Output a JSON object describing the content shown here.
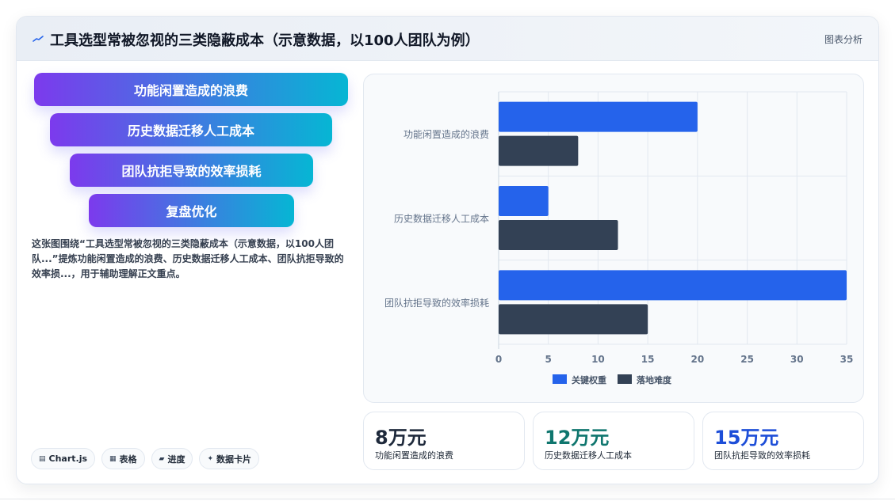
{
  "header": {
    "title": "工具选型常被忽视的三类隐蔽成本（示意数据，以100人团队为例）",
    "right_link": "图表分析",
    "icon": "chart-line-icon"
  },
  "funnel": [
    "功能闲置造成的浪费",
    "历史数据迁移人工成本",
    "团队抗拒导致的效率损耗",
    "复盘优化"
  ],
  "description": "这张图围绕“工具选型常被忽视的三类隐蔽成本（示意数据，以100人团队...”提炼功能闲置造成的浪费、历史数据迁移人工成本、团队抗拒导致的效率损...，用于辅助理解正文重点。",
  "chips": [
    {
      "icon": "▤",
      "label": "Chart.js"
    },
    {
      "icon": "▦",
      "label": "表格"
    },
    {
      "icon": "▰",
      "label": "进度"
    },
    {
      "icon": "✦",
      "label": "数据卡片"
    }
  ],
  "chart_data": {
    "type": "bar",
    "orientation": "horizontal",
    "categories": [
      "功能闲置造成的浪费",
      "历史数据迁移人工成本",
      "团队抗拒导致的效率损耗"
    ],
    "series": [
      {
        "name": "关键权重",
        "values": [
          20,
          5,
          35
        ],
        "color": "#2563eb"
      },
      {
        "name": "落地难度",
        "values": [
          8,
          12,
          15
        ],
        "color": "#334155"
      }
    ],
    "xlim": [
      0,
      35
    ],
    "xticks": [
      0,
      5,
      10,
      15,
      20,
      25,
      30,
      35
    ],
    "grid": true,
    "legend": "bottom"
  },
  "stats": [
    {
      "value": "8万元",
      "label": "功能闲置造成的浪费",
      "color": "#1e293b"
    },
    {
      "value": "12万元",
      "label": "历史数据迁移人工成本",
      "color": "#0f766e"
    },
    {
      "value": "15万元",
      "label": "团队抗拒导致的效率损耗",
      "color": "#1d4ed8"
    }
  ]
}
